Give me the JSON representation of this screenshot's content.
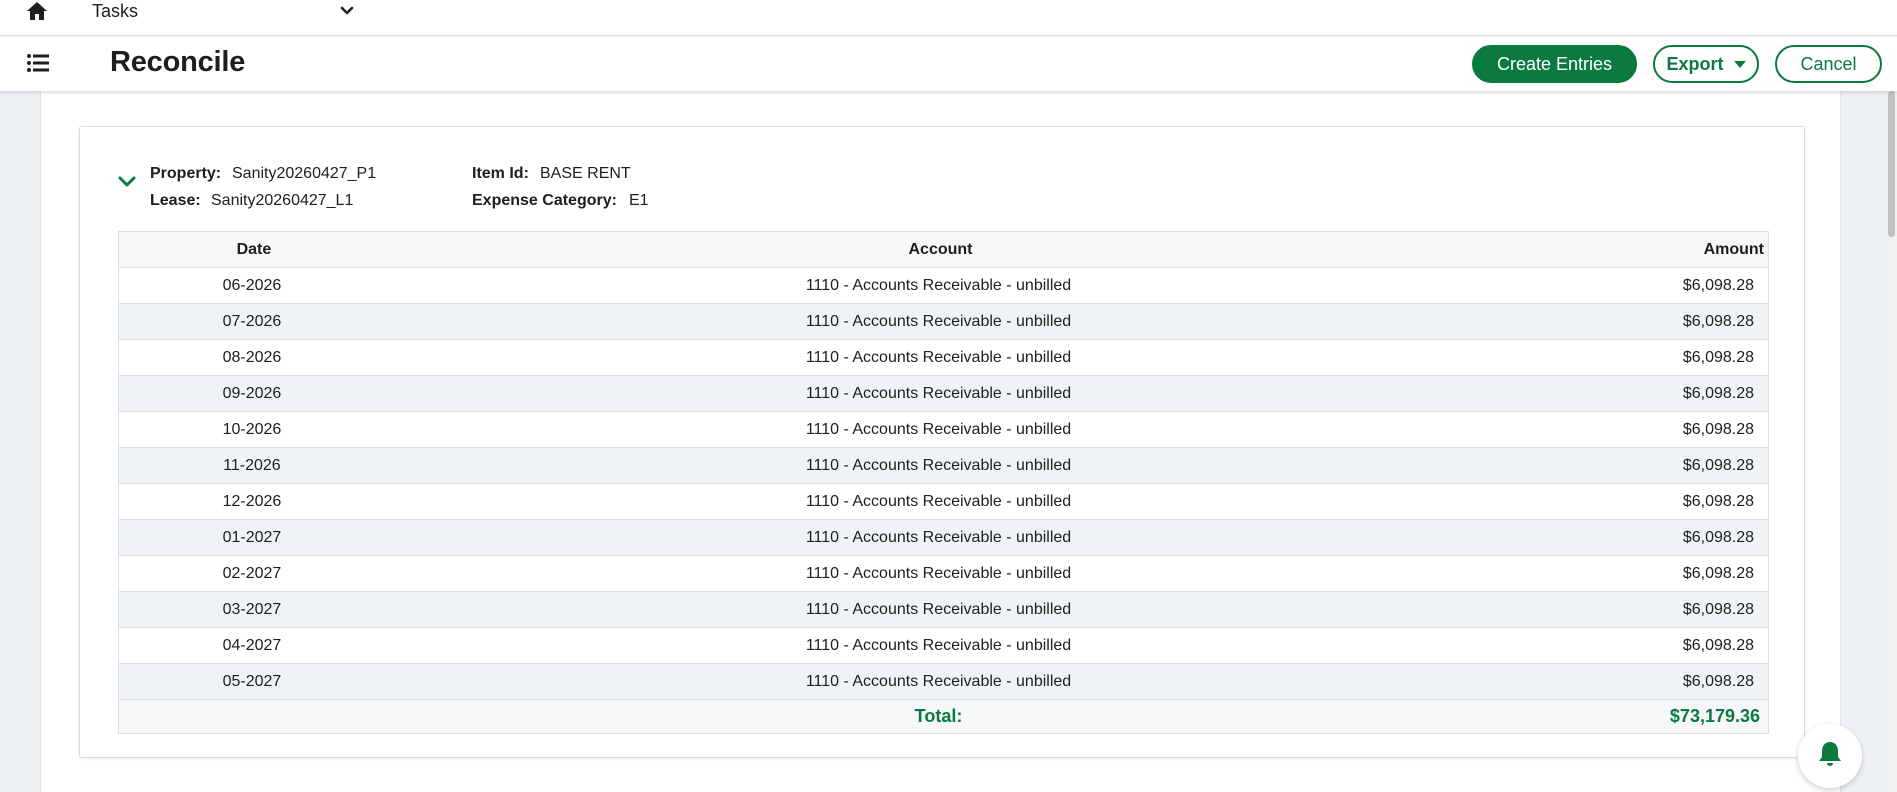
{
  "topbar": {
    "module_select": "Tasks"
  },
  "header": {
    "title": "Reconcile",
    "create_label": "Create Entries",
    "export_label": "Export",
    "cancel_label": "Cancel"
  },
  "details": {
    "property_label": "Property:",
    "property_value": "Sanity20260427_P1",
    "lease_label": "Lease:",
    "lease_value": "Sanity20260427_L1",
    "item_id_label": "Item Id:",
    "item_id_value": "BASE RENT",
    "expense_category_label": "Expense Category:",
    "expense_category_value": "E1"
  },
  "table": {
    "headers": {
      "date": "Date",
      "account": "Account",
      "amount": "Amount"
    },
    "rows": [
      {
        "date": "06-2026",
        "account": "1110 - Accounts Receivable - unbilled",
        "amount": "$6,098.28"
      },
      {
        "date": "07-2026",
        "account": "1110 - Accounts Receivable - unbilled",
        "amount": "$6,098.28"
      },
      {
        "date": "08-2026",
        "account": "1110 - Accounts Receivable - unbilled",
        "amount": "$6,098.28"
      },
      {
        "date": "09-2026",
        "account": "1110 - Accounts Receivable - unbilled",
        "amount": "$6,098.28"
      },
      {
        "date": "10-2026",
        "account": "1110 - Accounts Receivable - unbilled",
        "amount": "$6,098.28"
      },
      {
        "date": "11-2026",
        "account": "1110 - Accounts Receivable - unbilled",
        "amount": "$6,098.28"
      },
      {
        "date": "12-2026",
        "account": "1110 - Accounts Receivable - unbilled",
        "amount": "$6,098.28"
      },
      {
        "date": "01-2027",
        "account": "1110 - Accounts Receivable - unbilled",
        "amount": "$6,098.28"
      },
      {
        "date": "02-2027",
        "account": "1110 - Accounts Receivable - unbilled",
        "amount": "$6,098.28"
      },
      {
        "date": "03-2027",
        "account": "1110 - Accounts Receivable - unbilled",
        "amount": "$6,098.28"
      },
      {
        "date": "04-2027",
        "account": "1110 - Accounts Receivable - unbilled",
        "amount": "$6,098.28"
      },
      {
        "date": "05-2027",
        "account": "1110 - Accounts Receivable - unbilled",
        "amount": "$6,098.28"
      }
    ],
    "total_label": "Total:",
    "total_value": "$73,179.36"
  },
  "icons": {
    "home": "home-icon",
    "dropdown": "chevron-down-icon",
    "menu": "list-icon",
    "collapse": "chevron-down-icon",
    "notifications": "bell-icon"
  },
  "colors": {
    "brand_green": "#0a7a40",
    "page_background": "#eef1f4",
    "row_alt": "#f0f3f5"
  }
}
